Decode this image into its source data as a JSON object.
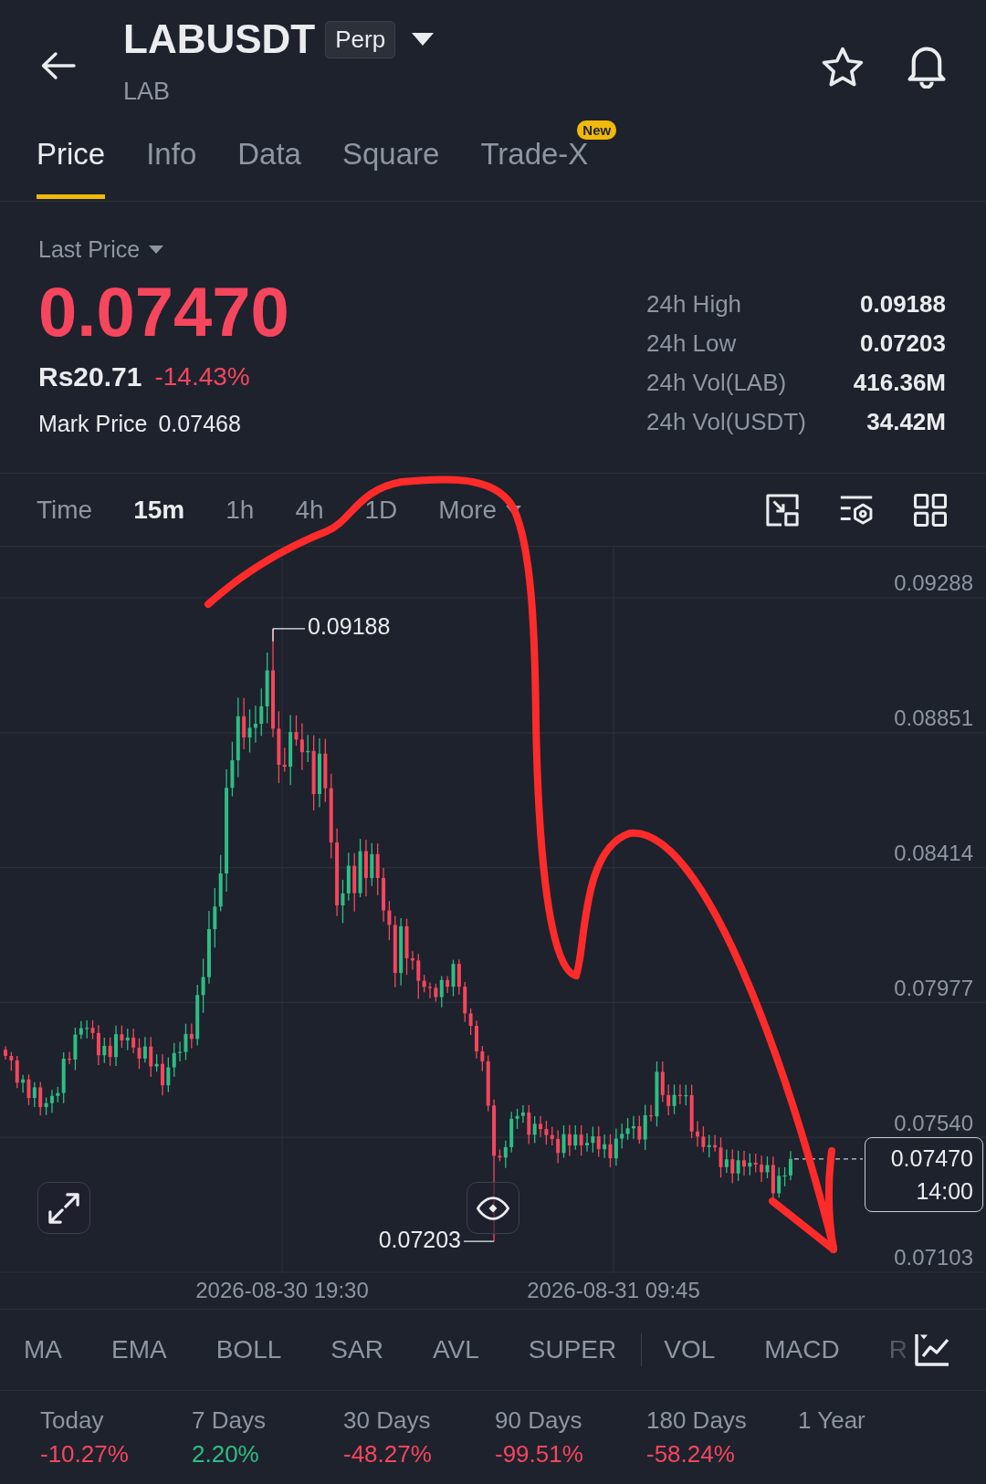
{
  "header": {
    "symbol": "LABUSDT",
    "contract_badge": "Perp",
    "base_asset": "LAB"
  },
  "tabs": [
    {
      "label": "Price",
      "selected": true
    },
    {
      "label": "Info",
      "selected": false
    },
    {
      "label": "Data",
      "selected": false
    },
    {
      "label": "Square",
      "selected": false
    },
    {
      "label": "Trade-X",
      "selected": false,
      "badge": "New"
    }
  ],
  "price_panel": {
    "price_type": "Last Price",
    "last_price": "0.07470",
    "local_price": "Rs20.71",
    "change": "-14.43%",
    "negative": true,
    "mark_price_label": "Mark Price",
    "mark_price": "0.07468",
    "stats": [
      {
        "label": "24h High",
        "value": "0.09188"
      },
      {
        "label": "24h Low",
        "value": "0.07203"
      },
      {
        "label": "24h Vol(LAB)",
        "value": "416.36M"
      },
      {
        "label": "24h Vol(USDT)",
        "value": "34.42M"
      }
    ]
  },
  "chart_toolbar": {
    "intervals": [
      {
        "label": "Time",
        "kind": "option",
        "selected": false
      },
      {
        "label": "15m",
        "kind": "option",
        "selected": true
      },
      {
        "label": "1h",
        "kind": "option",
        "selected": false
      },
      {
        "label": "4h",
        "kind": "option",
        "selected": false
      },
      {
        "label": "1D",
        "kind": "option",
        "selected": false
      },
      {
        "label": "More",
        "kind": "menu",
        "selected": false
      }
    ]
  },
  "chart": {
    "price_axis": [
      "0.09288",
      "0.08851",
      "0.08414",
      "0.07977",
      "0.07540",
      "0.07103"
    ],
    "time_axis": [
      "2026-08-30 19:30",
      "2026-08-31 09:45"
    ],
    "high_marker": "0.09188",
    "low_marker": "0.07203",
    "price_tag": {
      "price": "0.07470",
      "countdown": "14:00"
    }
  },
  "indicators": [
    {
      "label": "MA",
      "kind": "main"
    },
    {
      "label": "EMA",
      "kind": "main"
    },
    {
      "label": "BOLL",
      "kind": "main"
    },
    {
      "label": "SAR",
      "kind": "main"
    },
    {
      "label": "AVL",
      "kind": "main"
    },
    {
      "label": "SUPER",
      "kind": "main"
    },
    {
      "label": "VOL",
      "kind": "sub"
    },
    {
      "label": "MACD",
      "kind": "sub"
    },
    {
      "label": "R",
      "kind": "sub"
    }
  ],
  "performance": [
    {
      "label": "Today",
      "value": "-10.27%",
      "negative": true
    },
    {
      "label": "7 Days",
      "value": "2.20%",
      "negative": false
    },
    {
      "label": "30 Days",
      "value": "-48.27%",
      "negative": true
    },
    {
      "label": "90 Days",
      "value": "-99.51%",
      "negative": true
    },
    {
      "label": "180 Days",
      "value": "-58.24%",
      "negative": true
    },
    {
      "label": "1 Year"
    }
  ]
}
